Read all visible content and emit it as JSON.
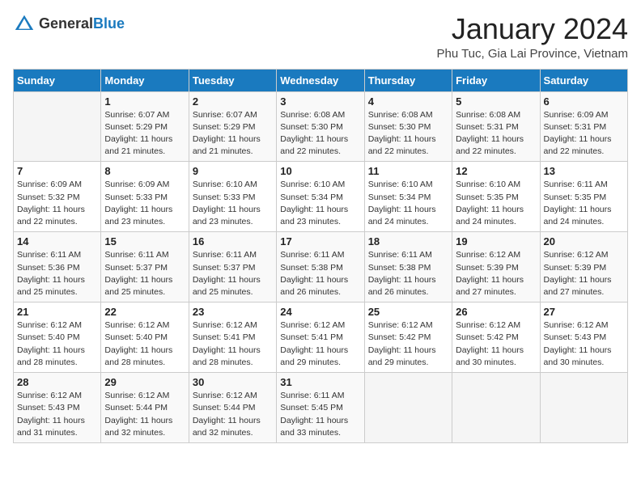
{
  "logo": {
    "text_general": "General",
    "text_blue": "Blue"
  },
  "header": {
    "title": "January 2024",
    "subtitle": "Phu Tuc, Gia Lai Province, Vietnam"
  },
  "weekdays": [
    "Sunday",
    "Monday",
    "Tuesday",
    "Wednesday",
    "Thursday",
    "Friday",
    "Saturday"
  ],
  "weeks": [
    [
      {
        "day": "",
        "info": ""
      },
      {
        "day": "1",
        "info": "Sunrise: 6:07 AM\nSunset: 5:29 PM\nDaylight: 11 hours\nand 21 minutes."
      },
      {
        "day": "2",
        "info": "Sunrise: 6:07 AM\nSunset: 5:29 PM\nDaylight: 11 hours\nand 21 minutes."
      },
      {
        "day": "3",
        "info": "Sunrise: 6:08 AM\nSunset: 5:30 PM\nDaylight: 11 hours\nand 22 minutes."
      },
      {
        "day": "4",
        "info": "Sunrise: 6:08 AM\nSunset: 5:30 PM\nDaylight: 11 hours\nand 22 minutes."
      },
      {
        "day": "5",
        "info": "Sunrise: 6:08 AM\nSunset: 5:31 PM\nDaylight: 11 hours\nand 22 minutes."
      },
      {
        "day": "6",
        "info": "Sunrise: 6:09 AM\nSunset: 5:31 PM\nDaylight: 11 hours\nand 22 minutes."
      }
    ],
    [
      {
        "day": "7",
        "info": "Sunrise: 6:09 AM\nSunset: 5:32 PM\nDaylight: 11 hours\nand 22 minutes."
      },
      {
        "day": "8",
        "info": "Sunrise: 6:09 AM\nSunset: 5:33 PM\nDaylight: 11 hours\nand 23 minutes."
      },
      {
        "day": "9",
        "info": "Sunrise: 6:10 AM\nSunset: 5:33 PM\nDaylight: 11 hours\nand 23 minutes."
      },
      {
        "day": "10",
        "info": "Sunrise: 6:10 AM\nSunset: 5:34 PM\nDaylight: 11 hours\nand 23 minutes."
      },
      {
        "day": "11",
        "info": "Sunrise: 6:10 AM\nSunset: 5:34 PM\nDaylight: 11 hours\nand 24 minutes."
      },
      {
        "day": "12",
        "info": "Sunrise: 6:10 AM\nSunset: 5:35 PM\nDaylight: 11 hours\nand 24 minutes."
      },
      {
        "day": "13",
        "info": "Sunrise: 6:11 AM\nSunset: 5:35 PM\nDaylight: 11 hours\nand 24 minutes."
      }
    ],
    [
      {
        "day": "14",
        "info": "Sunrise: 6:11 AM\nSunset: 5:36 PM\nDaylight: 11 hours\nand 25 minutes."
      },
      {
        "day": "15",
        "info": "Sunrise: 6:11 AM\nSunset: 5:37 PM\nDaylight: 11 hours\nand 25 minutes."
      },
      {
        "day": "16",
        "info": "Sunrise: 6:11 AM\nSunset: 5:37 PM\nDaylight: 11 hours\nand 25 minutes."
      },
      {
        "day": "17",
        "info": "Sunrise: 6:11 AM\nSunset: 5:38 PM\nDaylight: 11 hours\nand 26 minutes."
      },
      {
        "day": "18",
        "info": "Sunrise: 6:11 AM\nSunset: 5:38 PM\nDaylight: 11 hours\nand 26 minutes."
      },
      {
        "day": "19",
        "info": "Sunrise: 6:12 AM\nSunset: 5:39 PM\nDaylight: 11 hours\nand 27 minutes."
      },
      {
        "day": "20",
        "info": "Sunrise: 6:12 AM\nSunset: 5:39 PM\nDaylight: 11 hours\nand 27 minutes."
      }
    ],
    [
      {
        "day": "21",
        "info": "Sunrise: 6:12 AM\nSunset: 5:40 PM\nDaylight: 11 hours\nand 28 minutes."
      },
      {
        "day": "22",
        "info": "Sunrise: 6:12 AM\nSunset: 5:40 PM\nDaylight: 11 hours\nand 28 minutes."
      },
      {
        "day": "23",
        "info": "Sunrise: 6:12 AM\nSunset: 5:41 PM\nDaylight: 11 hours\nand 28 minutes."
      },
      {
        "day": "24",
        "info": "Sunrise: 6:12 AM\nSunset: 5:41 PM\nDaylight: 11 hours\nand 29 minutes."
      },
      {
        "day": "25",
        "info": "Sunrise: 6:12 AM\nSunset: 5:42 PM\nDaylight: 11 hours\nand 29 minutes."
      },
      {
        "day": "26",
        "info": "Sunrise: 6:12 AM\nSunset: 5:42 PM\nDaylight: 11 hours\nand 30 minutes."
      },
      {
        "day": "27",
        "info": "Sunrise: 6:12 AM\nSunset: 5:43 PM\nDaylight: 11 hours\nand 30 minutes."
      }
    ],
    [
      {
        "day": "28",
        "info": "Sunrise: 6:12 AM\nSunset: 5:43 PM\nDaylight: 11 hours\nand 31 minutes."
      },
      {
        "day": "29",
        "info": "Sunrise: 6:12 AM\nSunset: 5:44 PM\nDaylight: 11 hours\nand 32 minutes."
      },
      {
        "day": "30",
        "info": "Sunrise: 6:12 AM\nSunset: 5:44 PM\nDaylight: 11 hours\nand 32 minutes."
      },
      {
        "day": "31",
        "info": "Sunrise: 6:11 AM\nSunset: 5:45 PM\nDaylight: 11 hours\nand 33 minutes."
      },
      {
        "day": "",
        "info": ""
      },
      {
        "day": "",
        "info": ""
      },
      {
        "day": "",
        "info": ""
      }
    ]
  ]
}
